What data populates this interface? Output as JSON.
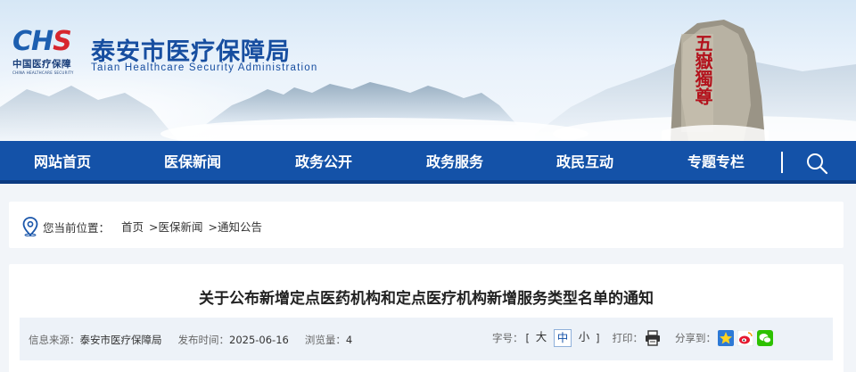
{
  "header": {
    "logo_mark_blue": "CH",
    "logo_mark_red": "S",
    "logo_cn": "中国医疗保障",
    "logo_en": "CHINA HEALTHCARE SECURITY",
    "site_title": "泰安市医疗保障局",
    "site_subtitle": "Taian Healthcare Security Administration",
    "rock_inscription": "五嶽獨尊"
  },
  "nav": {
    "items": [
      {
        "label": "网站首页"
      },
      {
        "label": "医保新闻"
      },
      {
        "label": "政务公开"
      },
      {
        "label": "政务服务"
      },
      {
        "label": "政民互动"
      },
      {
        "label": "专题专栏"
      }
    ],
    "search_icon": "search-icon"
  },
  "breadcrumb": {
    "label": "您当前位置：",
    "links": [
      "首页",
      ">医保新闻",
      ">通知公告"
    ],
    "icon": "location-pin-icon"
  },
  "article": {
    "title": "关于公布新增定点医药机构和定点医疗机构新增服务类型名单的通知",
    "meta": {
      "source_label": "信息来源：",
      "source_value": "泰安市医疗保障局",
      "date_label": "发布时间：",
      "date_value": "2025-06-16",
      "views_label": "浏览量：",
      "views_value": "4",
      "font_size_label": "字号：",
      "bracket_open": "[",
      "bracket_close": "]",
      "font_sizes": [
        "大",
        "中",
        "小"
      ],
      "active_font_size": "中",
      "print_label": "打印：",
      "share_label": "分享到："
    }
  },
  "colors": {
    "nav_bg": "#1452a8",
    "brand_blue": "#174ea0",
    "brand_red": "#d7262e",
    "page_bg": "#f2f5f9",
    "meta_bg": "#edf2f8"
  }
}
